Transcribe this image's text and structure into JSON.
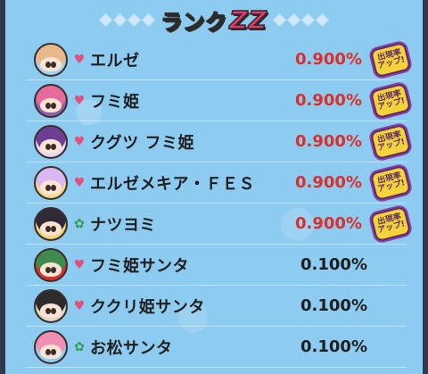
{
  "header": {
    "title_prefix": "ランク",
    "title_rank": "ZZ"
  },
  "colors": {
    "up_rate": "#d9302c",
    "normal_rate": "#1e1e1e",
    "badge_bg": "#f6d23a",
    "badge_border": "#5a2c66"
  },
  "badge": {
    "line1": "出現率",
    "line2": "アップ!"
  },
  "items": [
    {
      "name": "エルゼ",
      "tribe": "heart-icon",
      "rate": "0.900%",
      "boosted": true,
      "avatar_color": "#e7b98a",
      "accent": "#9fd3f2"
    },
    {
      "name": "フミ姫",
      "tribe": "heart-icon",
      "rate": "0.900%",
      "boosted": true,
      "avatar_color": "#e76a9c",
      "accent": "#8a5fb0"
    },
    {
      "name": "クグツ フミ姫",
      "tribe": "heart-icon",
      "rate": "0.900%",
      "boosted": true,
      "avatar_color": "#6c3f93",
      "accent": "#e9d6f6"
    },
    {
      "name": "エルゼメキア・ＦＥＳ",
      "tribe": "heart-icon",
      "rate": "0.900%",
      "boosted": true,
      "avatar_color": "#d9b7f0",
      "accent": "#f3d98b"
    },
    {
      "name": "ナツヨミ",
      "tribe": "clover-icon",
      "rate": "0.900%",
      "boosted": true,
      "avatar_color": "#2f2a36",
      "accent": "#f1d37a"
    },
    {
      "name": "フミ姫サンタ",
      "tribe": "heart-icon",
      "rate": "0.100%",
      "boosted": false,
      "avatar_color": "#3f8a4c",
      "accent": "#d9302c"
    },
    {
      "name": "ククリ姫サンタ",
      "tribe": "heart-icon",
      "rate": "0.100%",
      "boosted": false,
      "avatar_color": "#2c2c2c",
      "accent": "#e0d8c8"
    },
    {
      "name": "お松サンタ",
      "tribe": "clover-icon",
      "rate": "0.100%",
      "boosted": false,
      "avatar_color": "#f08fb4",
      "accent": "#8fd0f4"
    }
  ]
}
